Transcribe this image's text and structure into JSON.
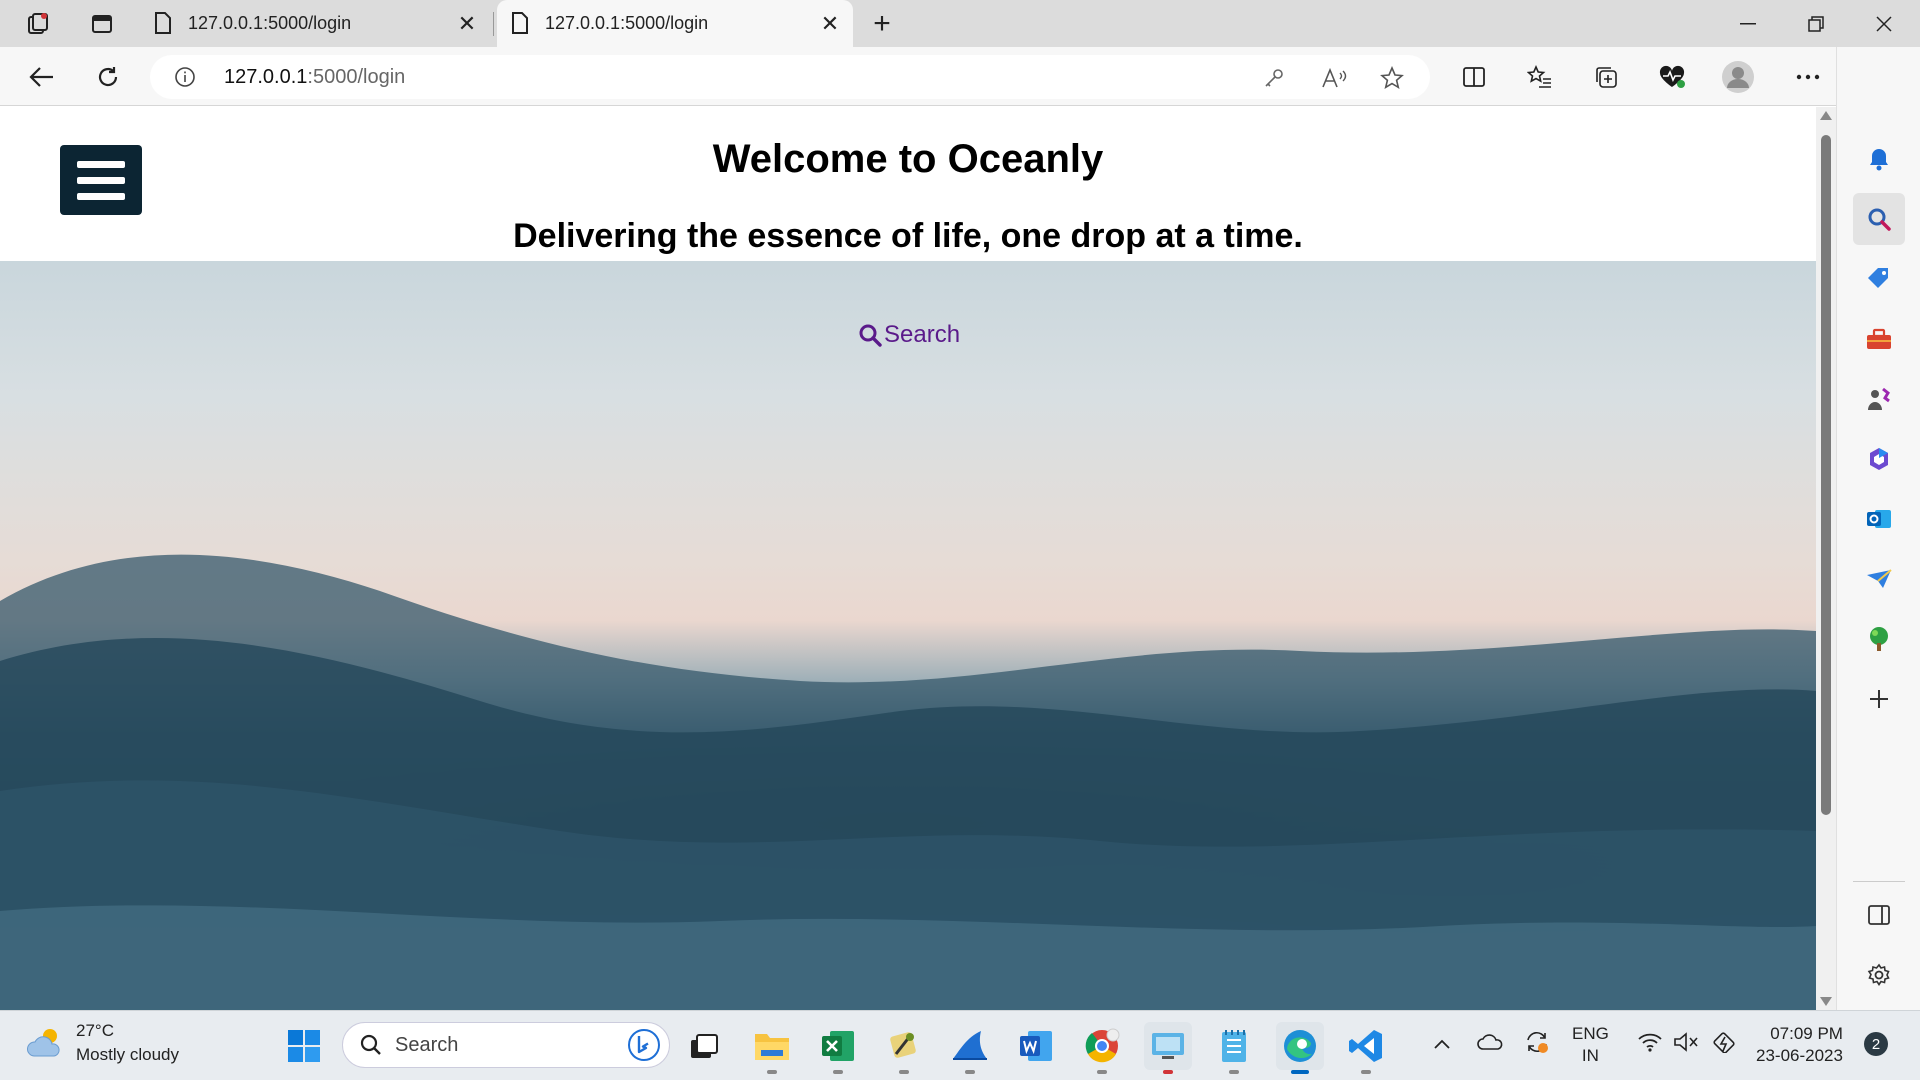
{
  "browser": {
    "tabs": [
      {
        "title": "127.0.0.1:5000/login",
        "active": false
      },
      {
        "title": "127.0.0.1:5000/login",
        "active": true
      }
    ],
    "address": {
      "host": "127.0.0.1",
      "rest": ":5000/login"
    }
  },
  "page": {
    "title": "Welcome to Oceanly",
    "subtitle": "Delivering the essence of life, one drop at a time.",
    "search_label": "Search",
    "colors": {
      "menu_button": "#0c2533",
      "search_link": "#5a1a8a"
    }
  },
  "sidebar": {
    "items": [
      "bell-icon",
      "search-icon",
      "tag-icon",
      "toolbox-icon",
      "games-icon",
      "office-icon",
      "outlook-icon",
      "drop-icon",
      "tree-icon",
      "add-icon"
    ]
  },
  "taskbar": {
    "weather": {
      "temp": "27°C",
      "desc": "Mostly cloudy"
    },
    "search_placeholder": "Search",
    "lang": {
      "line1": "ENG",
      "line2": "IN"
    },
    "clock": {
      "time": "07:09 PM",
      "date": "23-06-2023"
    },
    "notifications": "2"
  }
}
